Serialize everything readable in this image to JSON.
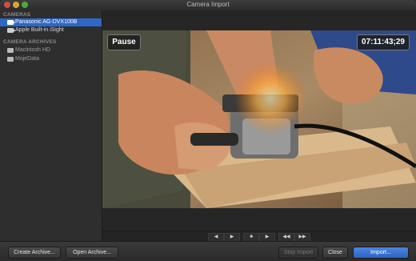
{
  "window": {
    "title": "Camera Import"
  },
  "sidebar": {
    "cameras_header": "CAMERAS",
    "cameras": [
      {
        "label": "Panasonic AG-DVX100B",
        "selected": true,
        "icon": "camera-icon"
      },
      {
        "label": "Apple Built-in iSight",
        "selected": false,
        "icon": "camera-icon"
      }
    ],
    "archives_header": "CAMERA ARCHIVES",
    "archives": [
      {
        "label": "Macintosh HD",
        "icon": "drive-icon"
      },
      {
        "label": "MojeData",
        "icon": "drive-icon"
      }
    ]
  },
  "viewer": {
    "pause_label": "Pause",
    "timecode": "07:11:43;29"
  },
  "transport": {
    "buttons": [
      "◀",
      "▶",
      "■",
      "▶",
      "◀◀",
      "▶▶"
    ]
  },
  "footer": {
    "create_archive": "Create Archive...",
    "open_archive": "Open Archive...",
    "stop_import": "Stop Import",
    "close": "Close",
    "import": "Import..."
  },
  "colors": {
    "selection": "#2e67c7",
    "primary_button": "#3a72d4"
  }
}
